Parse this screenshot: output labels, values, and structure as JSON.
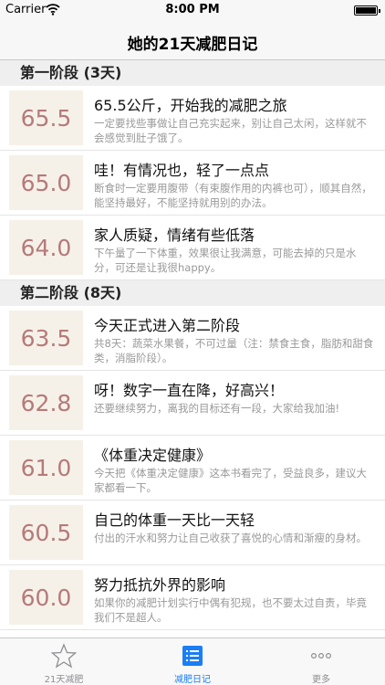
{
  "status_bar": {
    "carrier": "Carrier",
    "time": "8:00 PM"
  },
  "nav": {
    "title": "她的21天减肥日记"
  },
  "sections": [
    {
      "header": "第一阶段 (3天)",
      "rows": [
        {
          "weight": "65.5",
          "title": "65.5公斤，开始我的减肥之旅",
          "desc": "一定要找些事做让自己充实起来，别让自己太闲，这样就不会感觉到肚子饿了。"
        },
        {
          "weight": "65.0",
          "title": "哇！有情况也，轻了一点点",
          "desc": "断食时一定要用腹带（有束腹作用的内裤也可），顺其自然，能坚持最好，不能坚持就用别的办法。"
        },
        {
          "weight": "64.0",
          "title": "家人质疑，情绪有些低落",
          "desc": "下午量了一下体重，效果很让我满意，可能去掉的只是水分，可还是让我很happy。"
        }
      ]
    },
    {
      "header": "第二阶段 (8天)",
      "rows": [
        {
          "weight": "63.5",
          "title": "今天正式进入第二阶段",
          "desc": "共8天：蔬菜水果餐，不可过量（注：禁食主食，脂肪和甜食类，消脂阶段）。"
        },
        {
          "weight": "62.8",
          "title": "呀！数字一直在降，好高兴！",
          "desc": "还要继续努力，离我的目标还有一段，大家给我加油!"
        },
        {
          "weight": "61.0",
          "title": "《体重决定健康》",
          "desc": "今天把《体重决定健康》这本书看完了，受益良多，建议大家都看一下。"
        },
        {
          "weight": "60.5",
          "title": "自己的体重一天比一天轻",
          "desc": "付出的汗水和努力让自己收获了喜悦的心情和渐瘦的身材。"
        },
        {
          "weight": "60.0",
          "title": "努力抵抗外界的影响",
          "desc": "如果你的减肥计划实行中偶有犯规，也不要太过自责，毕竟我们不是超人。"
        }
      ]
    }
  ],
  "tabs": [
    {
      "label": "21天减肥",
      "icon": "star-icon"
    },
    {
      "label": "减肥日记",
      "icon": "list-icon",
      "active": true
    },
    {
      "label": "更多",
      "icon": "more-icon"
    }
  ],
  "colors": {
    "accent": "#1a7ef5",
    "weight_text": "#b57a7a",
    "weight_bg": "#f6f1e8"
  }
}
